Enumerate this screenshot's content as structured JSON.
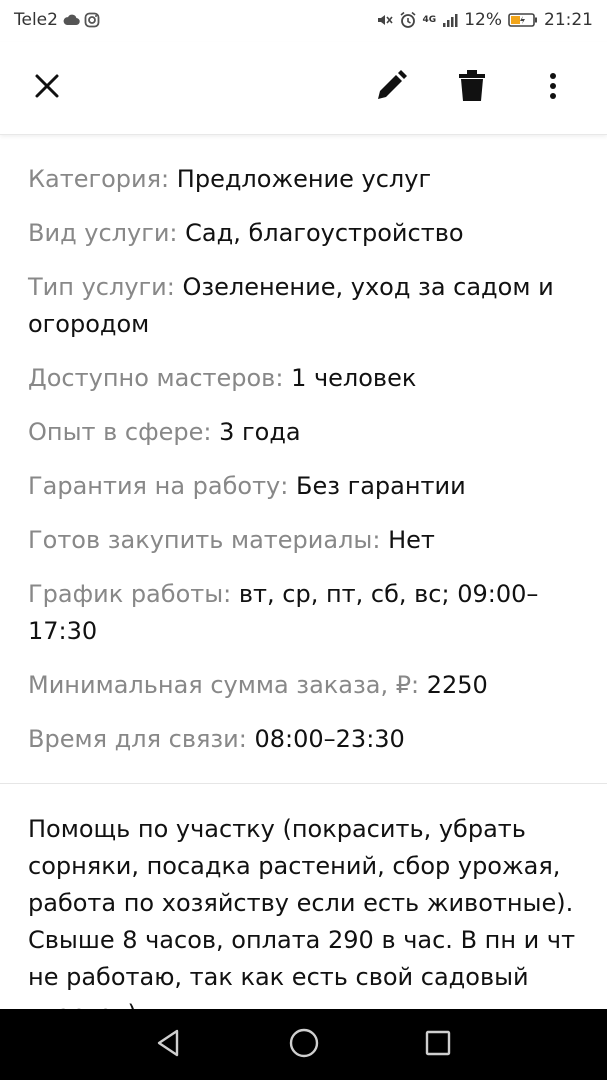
{
  "status_bar": {
    "carrier": "Tele2",
    "network": "4G",
    "battery": "12%",
    "time": "21:21"
  },
  "toolbar": {
    "icons": [
      "close-icon",
      "edit-icon",
      "delete-icon",
      "more-vert-icon"
    ]
  },
  "details": [
    {
      "label": "Категория:",
      "value": "Предложение услуг"
    },
    {
      "label": "Вид услуги:",
      "value": "Сад, благоустройство"
    },
    {
      "label": "Тип услуги:",
      "value": "Озеленение, уход за садом и огородом"
    },
    {
      "label": "Доступно мастеров:",
      "value": "1 человек"
    },
    {
      "label": "Опыт в сфере:",
      "value": "3 года"
    },
    {
      "label": "Гарантия на работу:",
      "value": "Без гарантии"
    },
    {
      "label": "Готов закупить материалы:",
      "value": "Нет"
    },
    {
      "label": "График работы:",
      "value": "вт, ср, пт, сб, вс; 09:00–17:30"
    },
    {
      "label": "Минимальная сумма заказа, ₽:",
      "value": "2250"
    },
    {
      "label": "Время для связи:",
      "value": "08:00–23:30"
    }
  ],
  "description": "Помощь по участку (покрасить, убрать сорняки, посадка растений, сбор урожая, работа по хозяйству если есть животные). Свыше 8 часов, оплата 290 в час. В пн и чт не работаю, так как есть свой садовый участок).",
  "colors": {
    "label": "#888888",
    "value": "#111111",
    "navbar": "#000000"
  }
}
